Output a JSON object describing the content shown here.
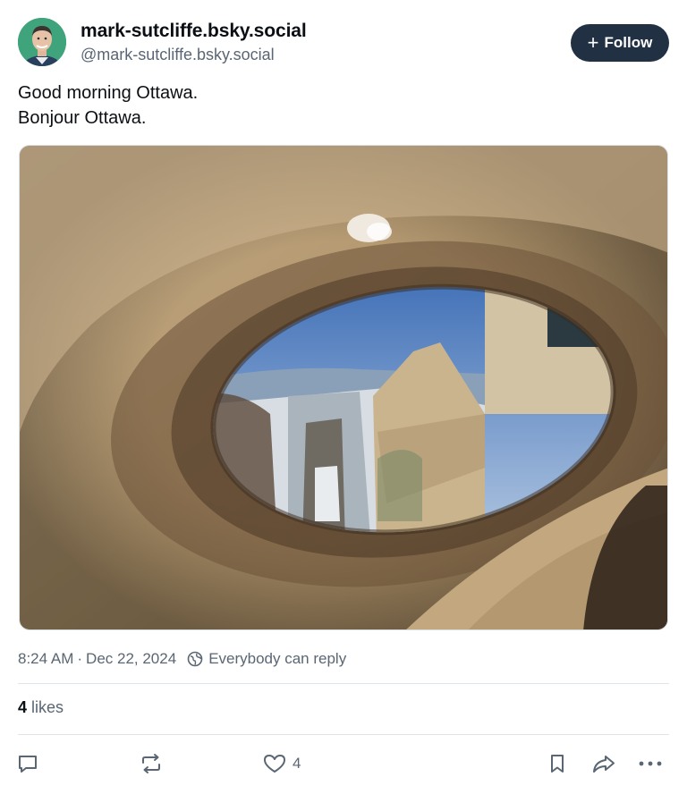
{
  "author": {
    "display_name": "mark-sutcliffe.bsky.social",
    "handle": "@mark-sutcliffe.bsky.social"
  },
  "follow_button": {
    "label": "Follow",
    "icon": "plus-icon"
  },
  "post": {
    "lines": [
      "Good morning Ottawa.",
      "Bonjour Ottawa."
    ],
    "image_subject": "view of Ottawa locks and canal through a hole in stone"
  },
  "meta": {
    "time": "8:24 AM",
    "separator": "·",
    "date": "Dec 22, 2024",
    "reply_setting": "Everybody can reply"
  },
  "likes": {
    "count": "4",
    "label": "likes"
  },
  "actions": {
    "reply": {
      "icon": "reply-icon"
    },
    "repost": {
      "icon": "repost-icon"
    },
    "like": {
      "icon": "heart-icon",
      "count": "4"
    },
    "bookmark": {
      "icon": "bookmark-icon"
    },
    "share": {
      "icon": "share-icon"
    },
    "more": {
      "icon": "more-icon"
    }
  },
  "colors": {
    "follow_bg": "#213043",
    "muted_text": "#5a6673",
    "divider": "#dfe4e9"
  }
}
